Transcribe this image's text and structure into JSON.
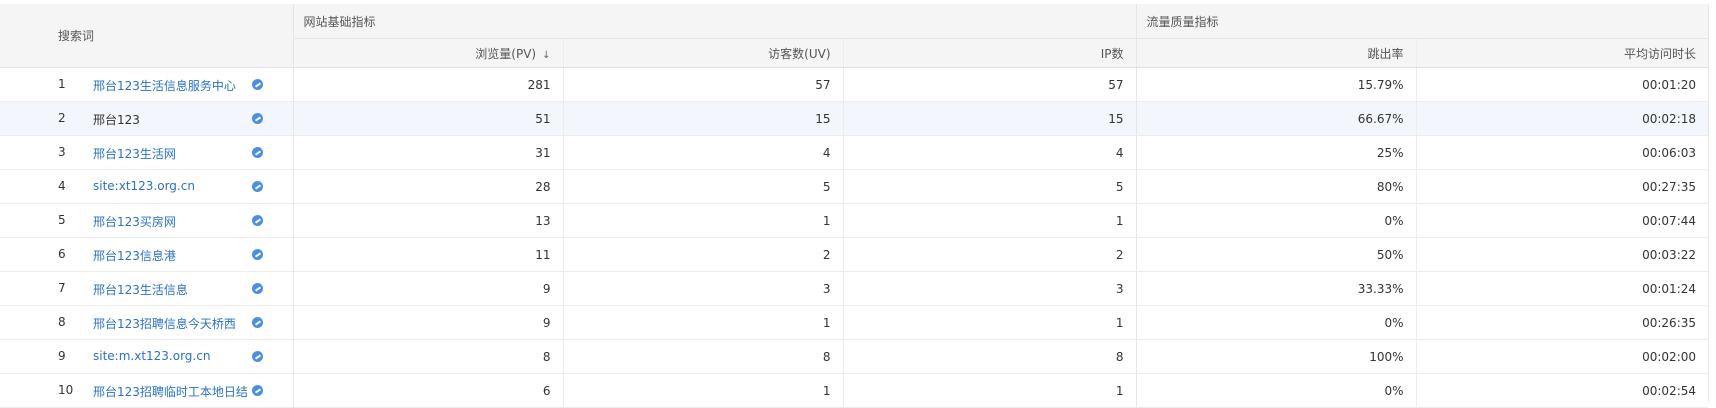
{
  "header": {
    "keyword_label": "搜索词",
    "group_site": "网站基础指标",
    "group_quality": "流量质量指标",
    "columns": {
      "pv": "浏览量(PV)",
      "uv": "访客数(UV)",
      "ip": "IP数",
      "bounce": "跳出率",
      "avg_time": "平均访问时长"
    },
    "sort_icon": "sort-desc-icon"
  },
  "rows": [
    {
      "index": "1",
      "term": "邢台123生活信息服务中心",
      "pv": "281",
      "uv": "57",
      "ip": "57",
      "bounce": "15.79%",
      "avg_time": "00:01:20"
    },
    {
      "index": "2",
      "term": "邢台123",
      "pv": "51",
      "uv": "15",
      "ip": "15",
      "bounce": "66.67%",
      "avg_time": "00:02:18"
    },
    {
      "index": "3",
      "term": "邢台123生活网",
      "pv": "31",
      "uv": "4",
      "ip": "4",
      "bounce": "25%",
      "avg_time": "00:06:03"
    },
    {
      "index": "4",
      "term": "site:xt123.org.cn",
      "pv": "28",
      "uv": "5",
      "ip": "5",
      "bounce": "80%",
      "avg_time": "00:27:35"
    },
    {
      "index": "5",
      "term": "邢台123买房网",
      "pv": "13",
      "uv": "1",
      "ip": "1",
      "bounce": "0%",
      "avg_time": "00:07:44"
    },
    {
      "index": "6",
      "term": "邢台123信息港",
      "pv": "11",
      "uv": "2",
      "ip": "2",
      "bounce": "50%",
      "avg_time": "00:03:22"
    },
    {
      "index": "7",
      "term": "邢台123生活信息",
      "pv": "9",
      "uv": "3",
      "ip": "3",
      "bounce": "33.33%",
      "avg_time": "00:01:24"
    },
    {
      "index": "8",
      "term": "邢台123招聘信息今天桥西",
      "pv": "9",
      "uv": "1",
      "ip": "1",
      "bounce": "0%",
      "avg_time": "00:26:35"
    },
    {
      "index": "9",
      "term": "site:m.xt123.org.cn",
      "pv": "8",
      "uv": "8",
      "ip": "8",
      "bounce": "100%",
      "avg_time": "00:02:00"
    },
    {
      "index": "10",
      "term": "邢台123招聘临时工本地日结",
      "pv": "6",
      "uv": "1",
      "ip": "1",
      "bounce": "0%",
      "avg_time": "00:02:54"
    }
  ],
  "colors": {
    "link": "#2a72c8",
    "header_bg": "#f5f5f5",
    "highlight_row": "#f3f6fd",
    "icon": "#4a8fe0"
  }
}
